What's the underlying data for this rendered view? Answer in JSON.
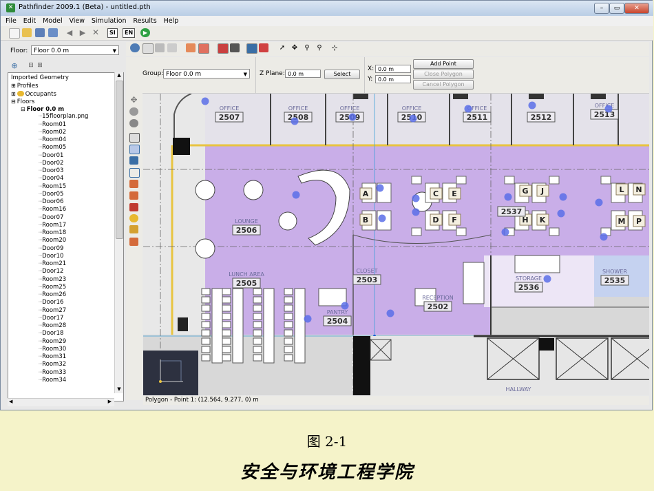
{
  "window": {
    "title": "Pathfinder 2009.1 (Beta) - untitled.pth",
    "app_icon": "pathfinder-logo-icon"
  },
  "menu": [
    "File",
    "Edit",
    "Model",
    "View",
    "Simulation",
    "Results",
    "Help"
  ],
  "toolbar": {
    "si_label": "SI",
    "en_label": "EN"
  },
  "floor_selector": {
    "label": "Floor:",
    "value": "Floor 0.0 m"
  },
  "tree": {
    "nodes": [
      {
        "text": "Imported Geometry",
        "level": 0
      },
      {
        "text": "Profiles",
        "level": 0,
        "expander": "+"
      },
      {
        "text": "Occupants",
        "level": 0,
        "expander": "+"
      },
      {
        "text": "Floors",
        "level": 0,
        "expander": "-"
      },
      {
        "text": "Floor 0.0 m",
        "level": 1,
        "expander": "-",
        "bold": true
      },
      {
        "text": "15floorplan.png",
        "level": 2
      },
      {
        "text": "Room01",
        "level": 2
      },
      {
        "text": "Room02",
        "level": 2
      },
      {
        "text": "Room04",
        "level": 2
      },
      {
        "text": "Room05",
        "level": 2
      },
      {
        "text": "Door01",
        "level": 2
      },
      {
        "text": "Door02",
        "level": 2
      },
      {
        "text": "Door03",
        "level": 2
      },
      {
        "text": "Door04",
        "level": 2
      },
      {
        "text": "Room15",
        "level": 2
      },
      {
        "text": "Door05",
        "level": 2
      },
      {
        "text": "Door06",
        "level": 2
      },
      {
        "text": "Room16",
        "level": 2
      },
      {
        "text": "Door07",
        "level": 2
      },
      {
        "text": "Room17",
        "level": 2
      },
      {
        "text": "Room18",
        "level": 2
      },
      {
        "text": "Room20",
        "level": 2
      },
      {
        "text": "Door09",
        "level": 2
      },
      {
        "text": "Door10",
        "level": 2
      },
      {
        "text": "Room21",
        "level": 2
      },
      {
        "text": "Door12",
        "level": 2
      },
      {
        "text": "Room23",
        "level": 2
      },
      {
        "text": "Room25",
        "level": 2
      },
      {
        "text": "Room26",
        "level": 2
      },
      {
        "text": "Door16",
        "level": 2
      },
      {
        "text": "Room27",
        "level": 2
      },
      {
        "text": "Door17",
        "level": 2
      },
      {
        "text": "Room28",
        "level": 2
      },
      {
        "text": "Door18",
        "level": 2
      },
      {
        "text": "Room29",
        "level": 2
      },
      {
        "text": "Room30",
        "level": 2
      },
      {
        "text": "Room31",
        "level": 2
      },
      {
        "text": "Room32",
        "level": 2
      },
      {
        "text": "Room33",
        "level": 2
      },
      {
        "text": "Room34",
        "level": 2
      }
    ]
  },
  "polygon_tool": {
    "group_label": "Group:",
    "group_value": "Floor 0.0 m",
    "zplane_label": "Z Plane:",
    "zplane_value": "0.0 m",
    "select_label": "Select",
    "x_label": "X:",
    "x_value": "0.0 m",
    "y_label": "Y:",
    "y_value": "0.0 m",
    "add_point_label": "Add Point",
    "close_polygon_label": "Close Polygon",
    "cancel_polygon_label": "Cancel Polygon"
  },
  "floorplan": {
    "rooms": [
      {
        "name": "OFFICE",
        "number": "2507"
      },
      {
        "name": "OFFICE",
        "number": "2508"
      },
      {
        "name": "OFFICE",
        "number": "2509"
      },
      {
        "name": "OFFICE",
        "number": "2510"
      },
      {
        "name": "OFFICE",
        "number": "2511"
      },
      {
        "name": "",
        "number": "2512"
      },
      {
        "name": "OFFICE",
        "number": "2513"
      },
      {
        "name": "LOUNGE",
        "number": "2506"
      },
      {
        "name": "LUNCH AREA",
        "number": "2505"
      },
      {
        "name": "PANTRY",
        "number": "2504"
      },
      {
        "name": "CLOSET",
        "number": "2503"
      },
      {
        "name": "RECEPTION",
        "number": "2502"
      },
      {
        "name": "",
        "number": "2537"
      },
      {
        "name": "STORAGE",
        "number": "2536"
      },
      {
        "name": "SHOWER",
        "number": "2535"
      },
      {
        "name": "HALLWAY",
        "number": ""
      }
    ],
    "desk_letters": [
      "A",
      "B",
      "C",
      "E",
      "D",
      "F",
      "G",
      "J",
      "H",
      "K",
      "L",
      "N",
      "M",
      "P"
    ]
  },
  "status_text": "Polygon - Point 1: (12.564, 9.277, 0) m",
  "captions": {
    "figure": "图 2-1",
    "school": "安全与环境工程学院"
  },
  "colors": {
    "room_fill": "#c9aee8",
    "occupant": "#5b6ee8",
    "slide_bg": "#f5f3c9"
  }
}
